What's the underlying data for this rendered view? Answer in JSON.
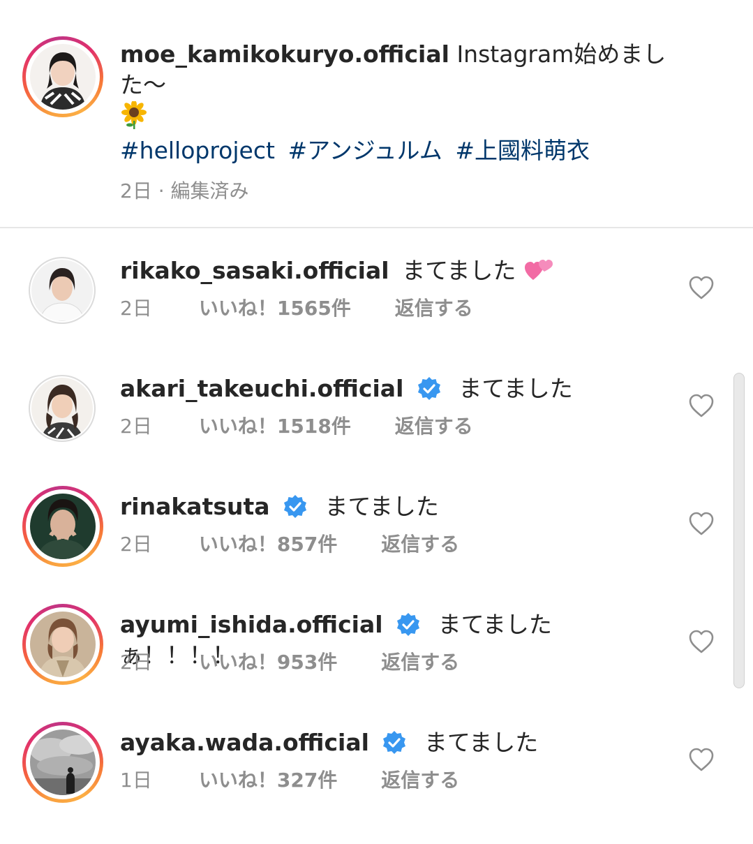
{
  "post": {
    "username": "moe_kamikokuryo.official",
    "caption_text": "Instagram始めました〜",
    "caption_emoji": "sunflower-emoji",
    "hashtags": [
      "#helloproject",
      "#アンジュルム",
      "#上國料萌衣"
    ],
    "time": "2日",
    "separator": "·",
    "edited": "編集済み"
  },
  "comments": [
    {
      "username": "rikako_sasaki.official",
      "verified": false,
      "text": "まてました",
      "emoji": "two-hearts-emoji",
      "time": "2日",
      "likes": "いいね！1565件",
      "reply": "返信する",
      "story_ring": false
    },
    {
      "username": "akari_takeuchi.official",
      "verified": true,
      "text": "まてました",
      "time": "2日",
      "likes": "いいね！1518件",
      "reply": "返信する",
      "story_ring": false
    },
    {
      "username": "rinakatsuta",
      "verified": true,
      "text": "まてました",
      "time": "2日",
      "likes": "いいね！857件",
      "reply": "返信する",
      "story_ring": true
    },
    {
      "username": "ayumi_ishida.official",
      "verified": true,
      "text": "まてましたぁ！！！！",
      "time": "2日",
      "likes": "いいね！953件",
      "reply": "返信する",
      "story_ring": true
    },
    {
      "username": "ayaka.wada.official",
      "verified": true,
      "text": "まてました",
      "time": "1日",
      "likes": "いいね！327件",
      "reply": "返信する",
      "story_ring": true
    }
  ],
  "colors": {
    "text": "#262626",
    "secondary": "#8e8e8e",
    "hashtag": "#00376b",
    "verified": "#3897f0",
    "divider": "#e6e6e6"
  },
  "icons": [
    "verified-badge-icon",
    "heart-icon"
  ]
}
